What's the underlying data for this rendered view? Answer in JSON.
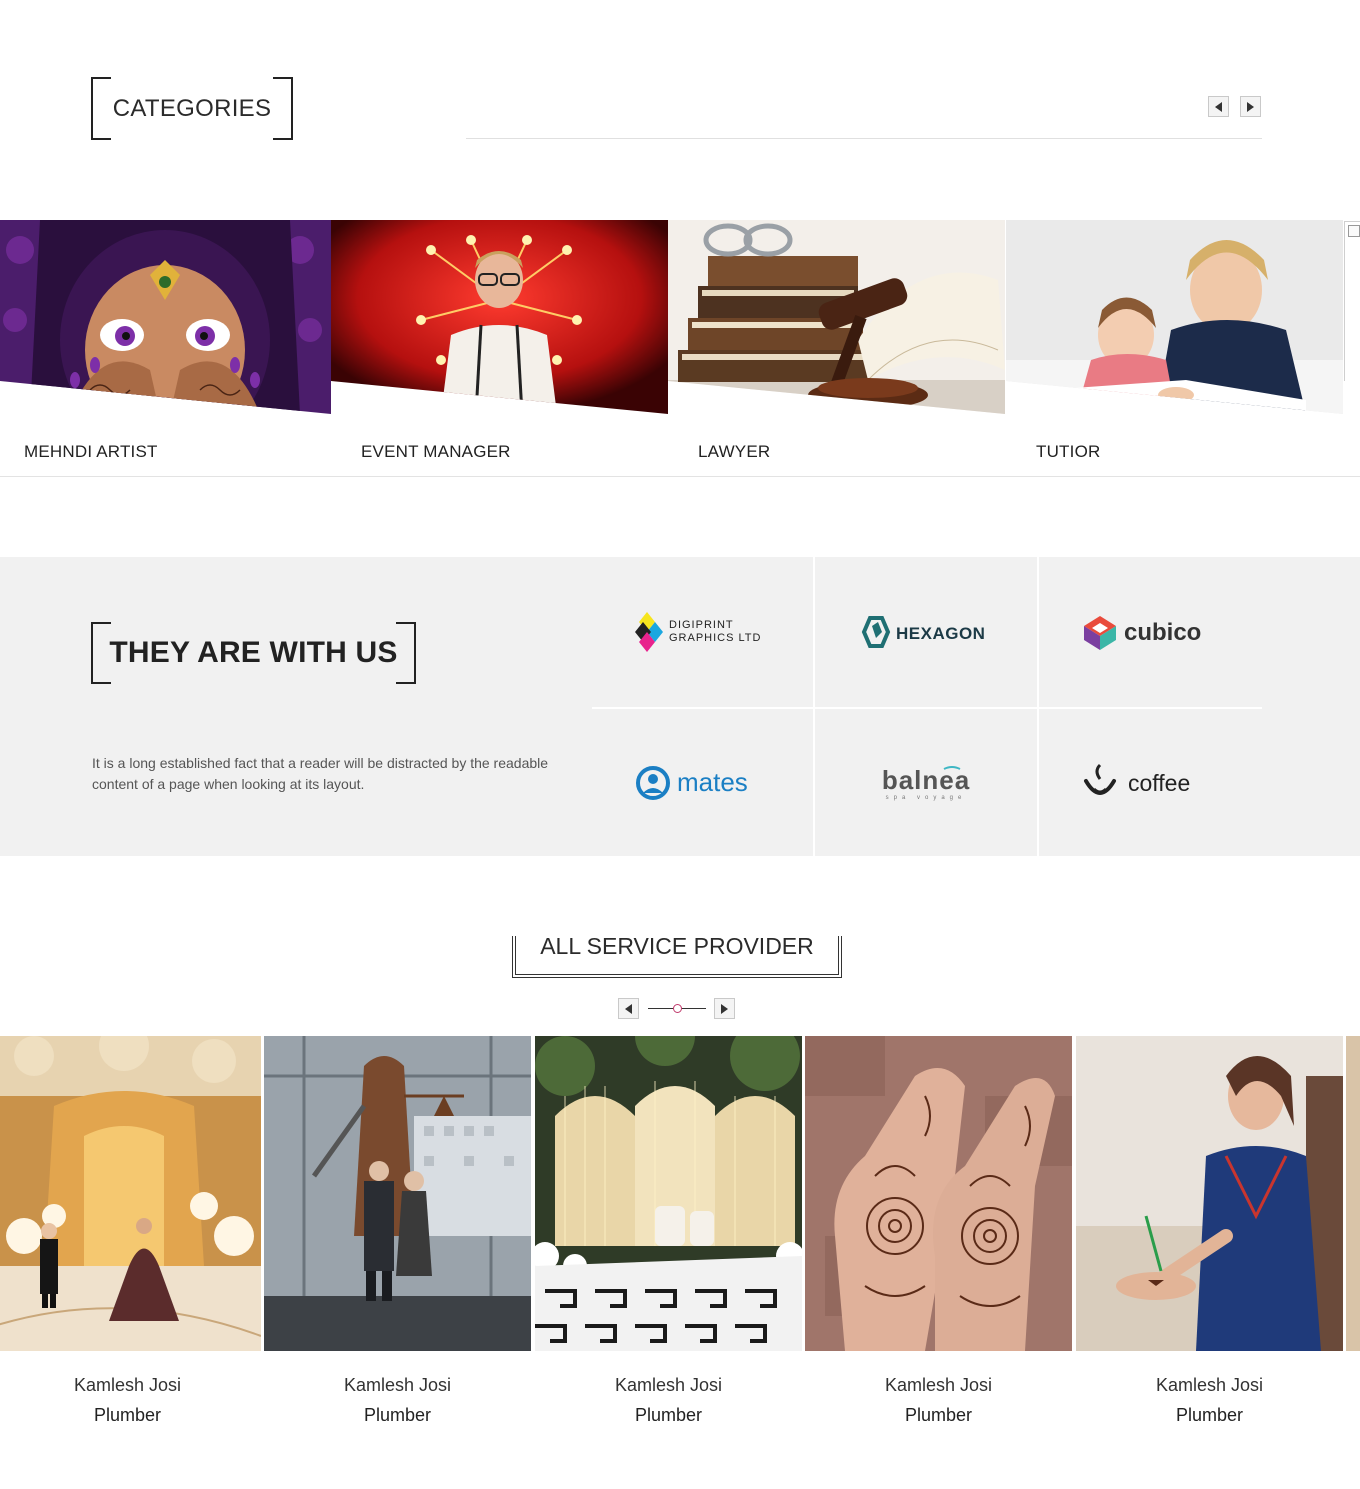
{
  "categories": {
    "title": "CATEGORIES",
    "items": [
      {
        "label": "MEHNDI ARTIST"
      },
      {
        "label": "EVENT MANAGER"
      },
      {
        "label": "LAWYER"
      },
      {
        "label": "TUTIOR"
      }
    ]
  },
  "partners": {
    "title": "THEY ARE WITH US",
    "description": "It is a long established fact that a reader will be distracted by the readable content of a page when looking at its layout.",
    "logos": [
      {
        "line1": "DIGIPRINT",
        "line2": "GRAPHICS LTD"
      },
      {
        "text": "HEXAGON"
      },
      {
        "text": "cubico"
      },
      {
        "text": "mates"
      },
      {
        "text": "balnea",
        "sub": "spa voyage"
      },
      {
        "text": "coffee"
      }
    ]
  },
  "providers": {
    "title": "ALL SERVICE PROVIDER",
    "items": [
      {
        "name": "Kamlesh Josi",
        "role": "Plumber"
      },
      {
        "name": "Kamlesh Josi",
        "role": "Plumber"
      },
      {
        "name": "Kamlesh Josi",
        "role": "Plumber"
      },
      {
        "name": "Kamlesh Josi",
        "role": "Plumber"
      },
      {
        "name": "Kamlesh Josi",
        "role": "Plumber"
      }
    ]
  },
  "colors": {
    "partners_bg": "#f1f1f1",
    "slider_dot": "#c0396b",
    "hexagon": "#1f6f73",
    "mates": "#1b7fc4"
  }
}
